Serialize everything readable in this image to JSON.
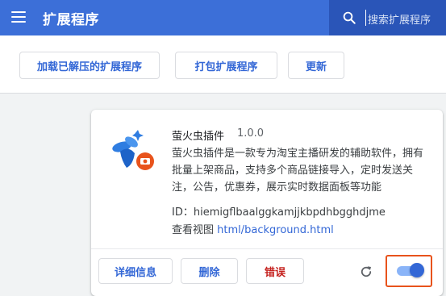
{
  "header": {
    "title": "扩展程序",
    "menu_icon": "hamburger-menu-icon",
    "search": {
      "placeholder": "搜索扩展程序",
      "icon": "search-icon"
    }
  },
  "toolbar": {
    "load_unpacked_label": "加载已解压的扩展程序",
    "pack_label": "打包扩展程序",
    "update_label": "更新"
  },
  "extension": {
    "name": "萤火虫插件",
    "version": "1.0.0",
    "description": "萤火虫插件是一款专为淘宝主播研发的辅助软件，拥有批量上架商品，支持多个商品链接导入，定时发送关注，公告，优惠券，展示实时数据面板等功能",
    "id_text": "ID：hiemigflbaalggkamjjkbpdhbgghdjme",
    "view_prefix": "查看视图",
    "view_link": "html/background.html",
    "details_label": "详细信息",
    "remove_label": "删除",
    "errors_label": "错误",
    "enabled": true
  },
  "colors": {
    "header_bg": "#3c6fd8",
    "accent": "#3367d6",
    "error": "#c5221f",
    "highlight": "#e8531c"
  }
}
